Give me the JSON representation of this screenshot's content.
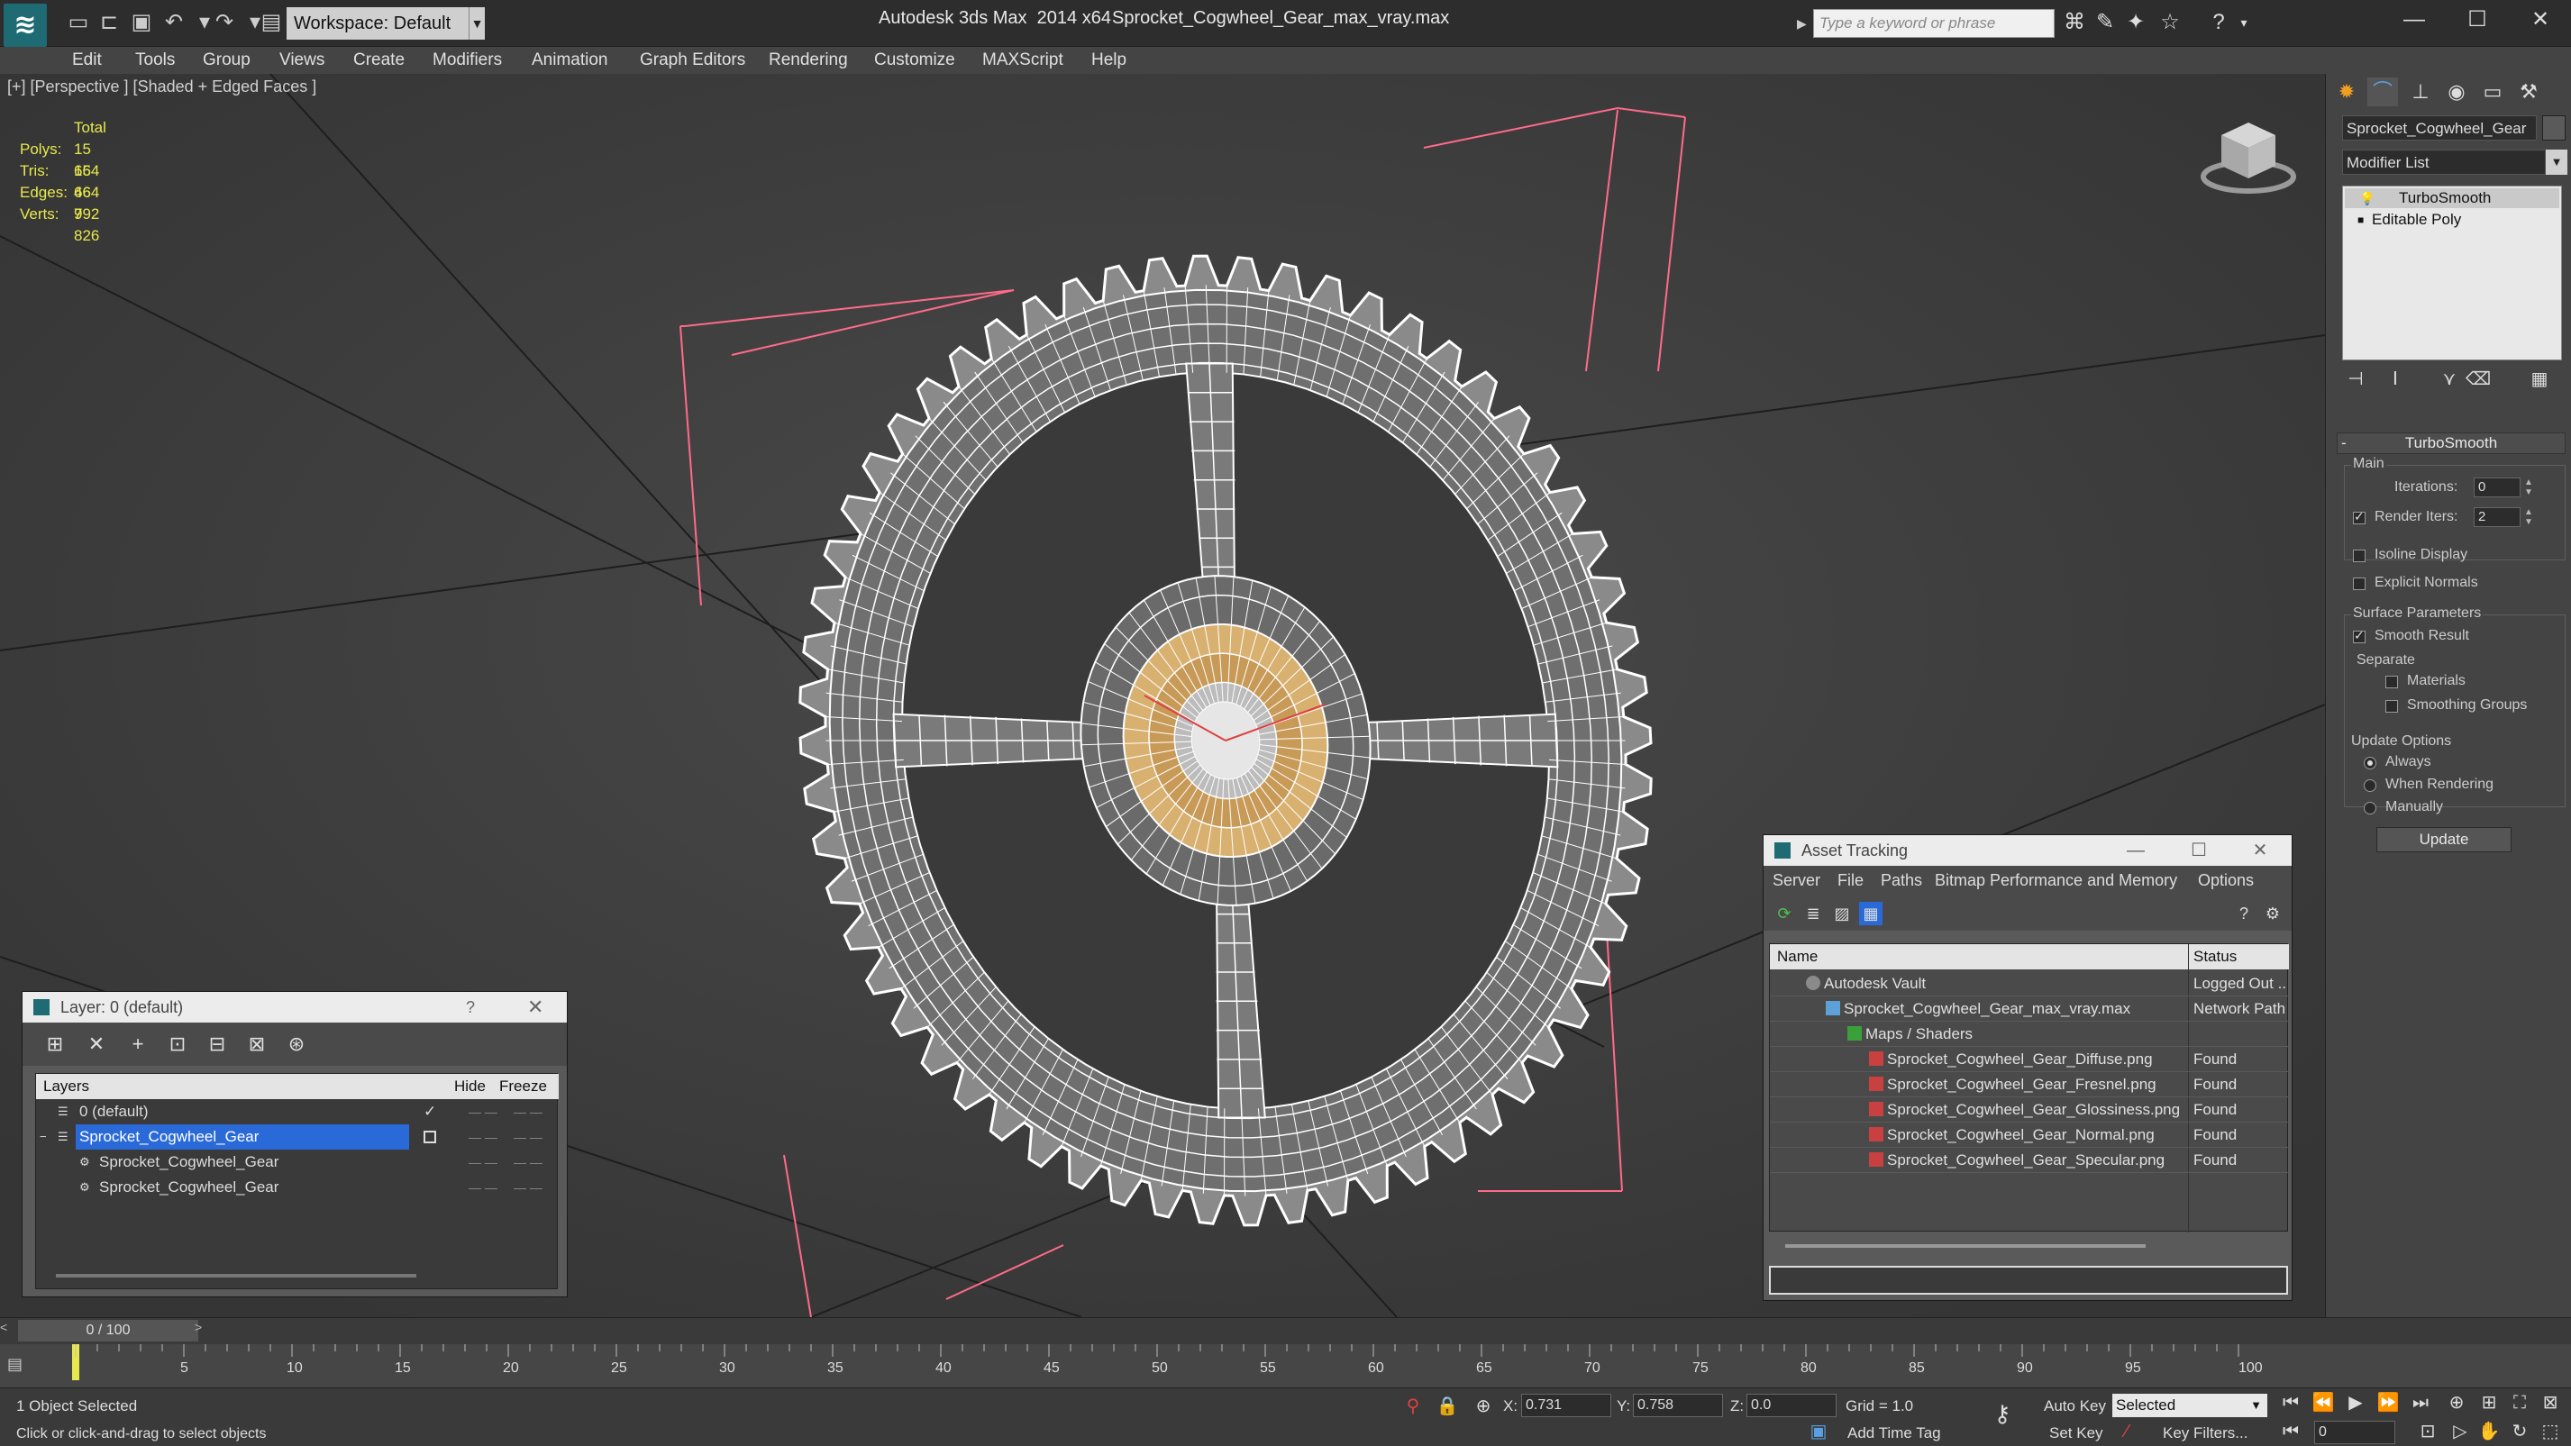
{
  "colors": {
    "accent": "#2a6ad8",
    "stats": "#e8e84e",
    "wire": "#ffffff",
    "selection": "#ff6b8a",
    "hub": "#d8b070"
  },
  "titlebar": {
    "app_title": "Autodesk 3ds Max  2014 x64",
    "file_title": "Sprocket_Cogwheel_Gear_max_vray.max",
    "workspace": "Workspace: Default",
    "search_placeholder": "Type a keyword or phrase"
  },
  "menu": [
    "Edit",
    "Tools",
    "Group",
    "Views",
    "Create",
    "Modifiers",
    "Animation",
    "Graph Editors",
    "Rendering",
    "Customize",
    "MAXScript",
    "Help"
  ],
  "viewport": {
    "label": "[+] [Perspective ] [Shaded + Edged Faces ]",
    "stats_header": "Total",
    "stats": [
      {
        "k": "Polys:",
        "v": "15 664"
      },
      {
        "k": "Tris:",
        "v": "15 664"
      },
      {
        "k": "Edges:",
        "v": "46 992"
      },
      {
        "k": "Verts:",
        "v": "7 826"
      }
    ]
  },
  "command_panel": {
    "object_name": "Sprocket_Cogwheel_Gear",
    "modifier_list": "Modifier List",
    "stack": [
      "TurboSmooth",
      "Editable Poly"
    ],
    "rollout_title": "TurboSmooth",
    "main_label": "Main",
    "iterations_label": "Iterations:",
    "iterations_value": "0",
    "render_iters_label": "Render Iters:",
    "render_iters_value": "2",
    "isoline_label": "Isoline Display",
    "explicit_normals_label": "Explicit Normals",
    "surface_label": "Surface Parameters",
    "smooth_result_label": "Smooth Result",
    "separate_label": "Separate",
    "materials_label": "Materials",
    "smoothing_groups_label": "Smoothing Groups",
    "update_options_label": "Update Options",
    "always_label": "Always",
    "when_rendering_label": "When Rendering",
    "manually_label": "Manually",
    "update_button": "Update"
  },
  "layer_panel": {
    "title": "Layer: 0 (default)",
    "help": "?",
    "col_layers": "Layers",
    "col_hide": "Hide",
    "col_freeze": "Freeze",
    "rows": [
      {
        "name": "0 (default)",
        "indent": 0
      },
      {
        "name": "Sprocket_Cogwheel_Gear",
        "indent": 0
      },
      {
        "name": "Sprocket_Cogwheel_Gear",
        "indent": 1
      },
      {
        "name": "Sprocket_Cogwheel_Gear",
        "indent": 1
      }
    ]
  },
  "asset_panel": {
    "title": "Asset Tracking",
    "menu": [
      "Server",
      "File",
      "Paths",
      "Bitmap Performance and Memory",
      "Options"
    ],
    "col_name": "Name",
    "col_status": "Status",
    "rows": [
      {
        "name": "Autodesk Vault",
        "status": "Logged Out ..."
      },
      {
        "name": "Sprocket_Cogwheel_Gear_max_vray.max",
        "status": "Network Path"
      },
      {
        "name": "Maps / Shaders",
        "status": ""
      },
      {
        "name": "Sprocket_Cogwheel_Gear_Diffuse.png",
        "status": "Found"
      },
      {
        "name": "Sprocket_Cogwheel_Gear_Fresnel.png",
        "status": "Found"
      },
      {
        "name": "Sprocket_Cogwheel_Gear_Glossiness.png",
        "status": "Found"
      },
      {
        "name": "Sprocket_Cogwheel_Gear_Normal.png",
        "status": "Found"
      },
      {
        "name": "Sprocket_Cogwheel_Gear_Specular.png",
        "status": "Found"
      }
    ]
  },
  "timeline": {
    "slider": "0 / 100",
    "ticks": [
      "5",
      "10",
      "15",
      "20",
      "25",
      "30",
      "35",
      "40",
      "45",
      "50",
      "55",
      "60",
      "65",
      "70",
      "75",
      "80",
      "85",
      "90",
      "95",
      "100"
    ]
  },
  "status": {
    "selection": "1 Object Selected",
    "prompt": "Click or click-and-drag to select objects",
    "x_label": "X:",
    "x_value": "0.731",
    "y_label": "Y:",
    "y_value": "0.758",
    "z_label": "Z:",
    "z_value": "0.0",
    "grid": "Grid = 1.0",
    "add_time_tag": "Add Time Tag",
    "auto_key": "Auto Key",
    "selected": "Selected",
    "set_key": "Set Key",
    "key_filters": "Key Filters...",
    "frame": "0"
  }
}
